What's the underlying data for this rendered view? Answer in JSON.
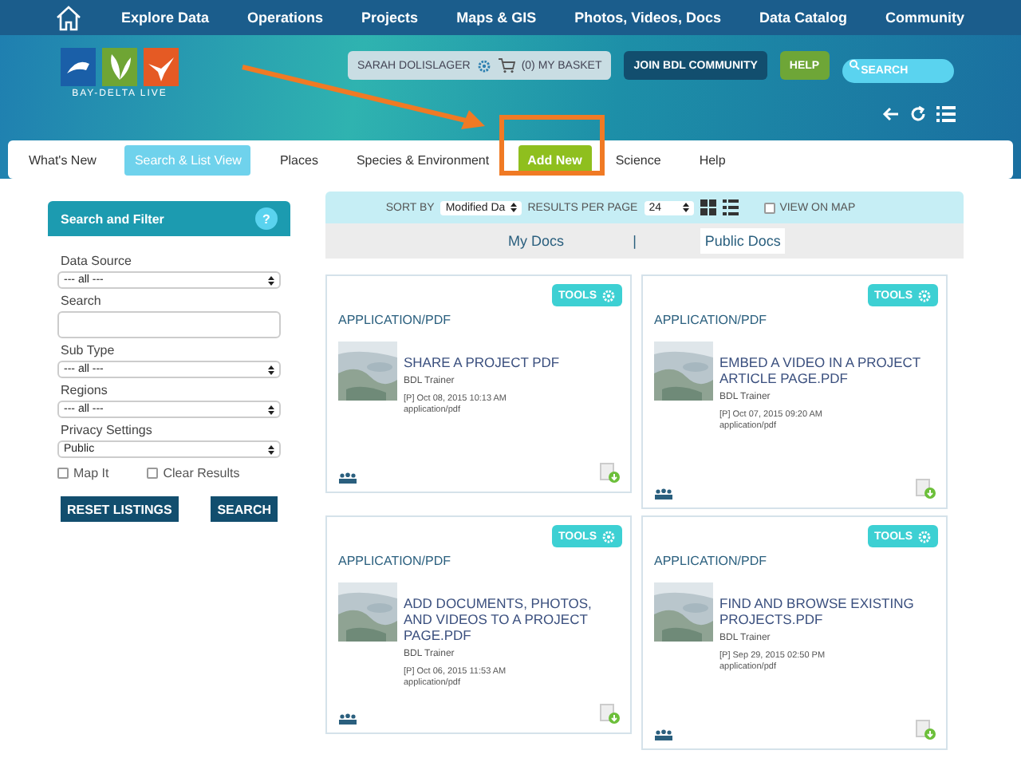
{
  "top_nav": [
    "Explore Data",
    "Operations",
    "Projects",
    "Maps & GIS",
    "Photos, Videos, Docs",
    "Data Catalog",
    "Community"
  ],
  "header": {
    "logo_text": "BAY-DELTA LIVE",
    "user": "SARAH DOLISLAGER",
    "basket": "(0) MY BASKET",
    "join": "JOIN BDL COMMUNITY",
    "help": "HELP",
    "search_placeholder": "SEARCH"
  },
  "tabs": [
    {
      "label": "What's New",
      "kind": "plain",
      "selected": false
    },
    {
      "label": "Search & List View",
      "kind": "plain",
      "selected": true
    },
    {
      "label": "Places",
      "kind": "plain",
      "selected": false
    },
    {
      "label": "Species & Environment",
      "kind": "plain",
      "selected": false
    },
    {
      "label": "Add New",
      "kind": "button",
      "selected": false
    },
    {
      "label": "Science",
      "kind": "plain",
      "selected": false
    },
    {
      "label": "Help",
      "kind": "plain",
      "selected": false
    }
  ],
  "sidebar": {
    "title": "Search and Filter",
    "help": "?",
    "fields": [
      {
        "kind": "select",
        "label": "Data Source",
        "value": "--- all ---"
      },
      {
        "kind": "input",
        "label": "Search"
      },
      {
        "kind": "select",
        "label": "Sub Type",
        "value": "--- all ---"
      },
      {
        "kind": "select",
        "label": "Regions",
        "value": "--- all ---"
      },
      {
        "kind": "select",
        "label": "Privacy Settings",
        "value": "Public"
      }
    ],
    "checkboxes": [
      {
        "label": "Map It",
        "checked": false
      },
      {
        "label": "Clear Results",
        "checked": false
      }
    ],
    "buttons": [
      "RESET LISTINGS",
      "SEARCH"
    ]
  },
  "toolbar": {
    "sort_label": "SORT BY",
    "sort_value": "Modified Da",
    "per_page_label": "RESULTS PER PAGE",
    "per_page_value": "24",
    "view_on_map": {
      "label": "VIEW ON MAP",
      "checked": false
    }
  },
  "doc_tabs": [
    {
      "label": "My Docs",
      "selected": false
    },
    {
      "label": "Public Docs",
      "selected": true
    }
  ],
  "doc_separator": "|",
  "cards": [
    {
      "tools": "TOOLS",
      "type": "APPLICATION/PDF",
      "title": "SHARE A PROJECT PDF",
      "author": "BDL Trainer",
      "date": "[P] Oct 08, 2015 10:13 AM",
      "mime": "application/pdf"
    },
    {
      "tools": "TOOLS",
      "type": "APPLICATION/PDF",
      "title": "EMBED A VIDEO IN A PROJECT ARTICLE PAGE.PDF",
      "author": "BDL Trainer",
      "date": "[P] Oct 07, 2015 09:20 AM",
      "mime": "application/pdf"
    },
    {
      "tools": "TOOLS",
      "type": "APPLICATION/PDF",
      "title": "ADD DOCUMENTS, PHOTOS, AND VIDEOS TO A PROJECT PAGE.PDF",
      "author": "BDL Trainer",
      "date": "[P] Oct 06, 2015 11:53 AM",
      "mime": "application/pdf"
    },
    {
      "tools": "TOOLS",
      "type": "APPLICATION/PDF",
      "title": "FIND AND BROWSE EXISTING PROJECTS.PDF",
      "author": "BDL Trainer",
      "date": "[P] Sep 29, 2015 02:50 PM",
      "mime": "application/pdf"
    }
  ]
}
